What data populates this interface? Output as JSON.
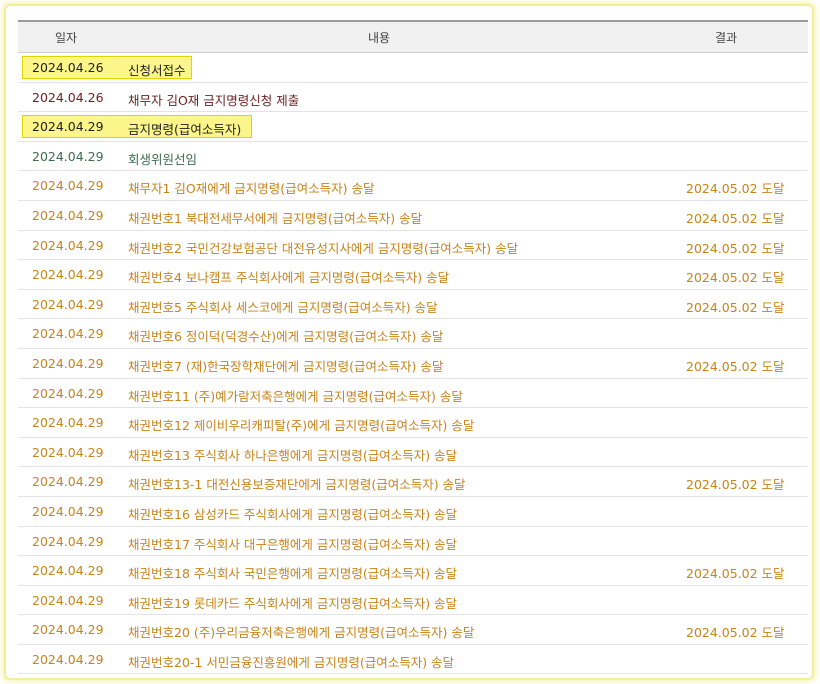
{
  "headers": {
    "date": "일자",
    "content": "내용",
    "result": "결과"
  },
  "rows": [
    {
      "date": "2024.04.26",
      "content": "신청서접수",
      "result": ""
    },
    {
      "date": "2024.04.26",
      "content": "채무자 김O재 금지명령신청 제출",
      "result": ""
    },
    {
      "date": "2024.04.29",
      "content": "금지명령(급여소득자)",
      "result": ""
    },
    {
      "date": "2024.04.29",
      "content": "회생위원선임",
      "result": ""
    },
    {
      "date": "2024.04.29",
      "content": "채무자1 김O재에게 금지명령(급여소득자) 송달",
      "result": "2024.05.02 도달"
    },
    {
      "date": "2024.04.29",
      "content": "채권번호1 북대전세무서에게 금지명령(급여소득자) 송달",
      "result": "2024.05.02 도달"
    },
    {
      "date": "2024.04.29",
      "content": "채권번호2 국민건강보험공단 대전유성지사에게 금지명령(급여소득자) 송달",
      "result": "2024.05.02 도달"
    },
    {
      "date": "2024.04.29",
      "content": "채권번호4 보나캠프 주식회사에게 금지명령(급여소득자) 송달",
      "result": "2024.05.02 도달"
    },
    {
      "date": "2024.04.29",
      "content": "채권번호5 주식회사 세스코에게 금지명령(급여소득자) 송달",
      "result": "2024.05.02 도달"
    },
    {
      "date": "2024.04.29",
      "content": "채권번호6 정이덕(덕경수산)에게 금지명령(급여소득자) 송달",
      "result": ""
    },
    {
      "date": "2024.04.29",
      "content": "채권번호7 (재)한국장학재단에게 금지명령(급여소득자) 송달",
      "result": "2024.05.02 도달"
    },
    {
      "date": "2024.04.29",
      "content": "채권번호11 (주)예가람저축은행에게 금지명령(급여소득자) 송달",
      "result": ""
    },
    {
      "date": "2024.04.29",
      "content": "채권번호12 제이비우리캐피탈(주)에게 금지명령(급여소득자) 송달",
      "result": ""
    },
    {
      "date": "2024.04.29",
      "content": "채권번호13 주식회사 하나은행에게 금지명령(급여소득자) 송달",
      "result": ""
    },
    {
      "date": "2024.04.29",
      "content": "채권번호13-1 대전신용보증재단에게 금지명령(급여소득자) 송달",
      "result": "2024.05.02 도달"
    },
    {
      "date": "2024.04.29",
      "content": "채권번호16 삼성카드 주식회사에게 금지명령(급여소득자) 송달",
      "result": ""
    },
    {
      "date": "2024.04.29",
      "content": "채권번호17 주식회사 대구은행에게 금지명령(급여소득자) 송달",
      "result": ""
    },
    {
      "date": "2024.04.29",
      "content": "채권번호18 주식회사 국민은행에게 금지명령(급여소득자) 송달",
      "result": "2024.05.02 도달"
    },
    {
      "date": "2024.04.29",
      "content": "채권번호19 롯데카드 주식회사에게 금지명령(급여소득자) 송달",
      "result": ""
    },
    {
      "date": "2024.04.29",
      "content": "채권번호20 (주)우리금융저축은행에게 금지명령(급여소득자) 송달",
      "result": "2024.05.02 도달"
    },
    {
      "date": "2024.04.29",
      "content": "채권번호20-1 서민금융진흥원에게 금지명령(급여소득자) 송달",
      "result": ""
    }
  ]
}
